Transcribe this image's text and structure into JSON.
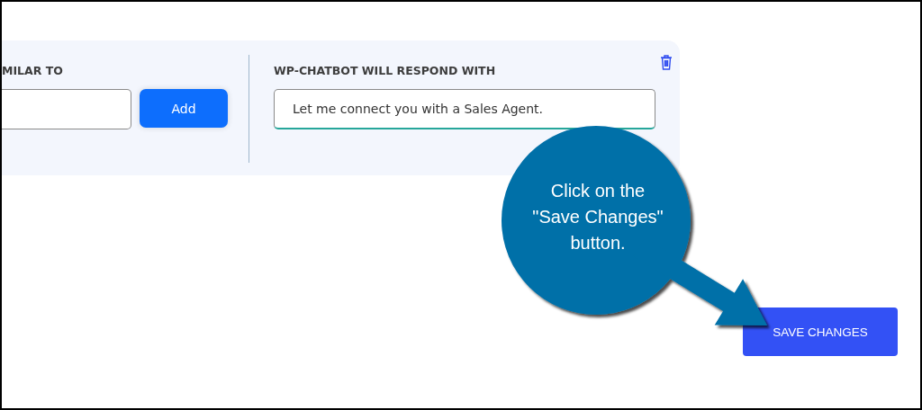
{
  "rule_panel": {
    "trigger_label": "MILAR TO",
    "add_button": "Add",
    "response_label": "WP-CHATBOT WILL RESPOND WITH",
    "response_input": {
      "value": "Let me connect you with a Sales Agent."
    }
  },
  "callout": {
    "text": "Click on the \"Save Changes\" button."
  },
  "save_button": "SAVE CHANGES"
}
